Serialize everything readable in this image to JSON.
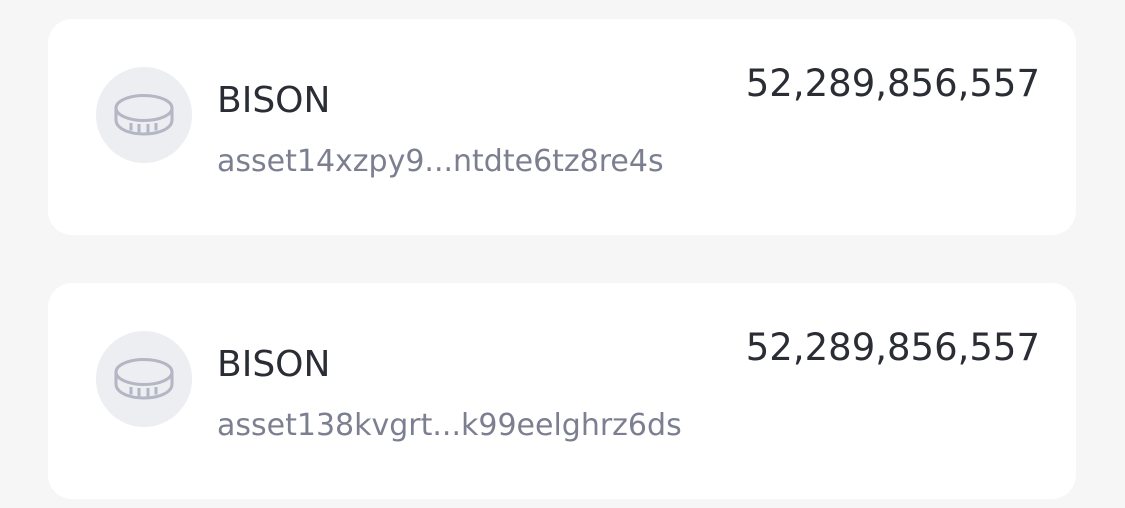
{
  "assets": [
    {
      "name": "BISON",
      "id": "asset14xzpy9...ntdte6tz8re4s",
      "amount": "52,289,856,557",
      "icon": "coin-icon"
    },
    {
      "name": "BISON",
      "id": "asset138kvgrt...k99eelghrz6ds",
      "amount": "52,289,856,557",
      "icon": "coin-icon"
    }
  ],
  "colors": {
    "background": "#f6f6f7",
    "card": "#ffffff",
    "icon_circle": "#edeef2",
    "icon_stroke": "#b3b6c4",
    "primary_text": "#2b2d35",
    "secondary_text": "#7c7f90"
  }
}
